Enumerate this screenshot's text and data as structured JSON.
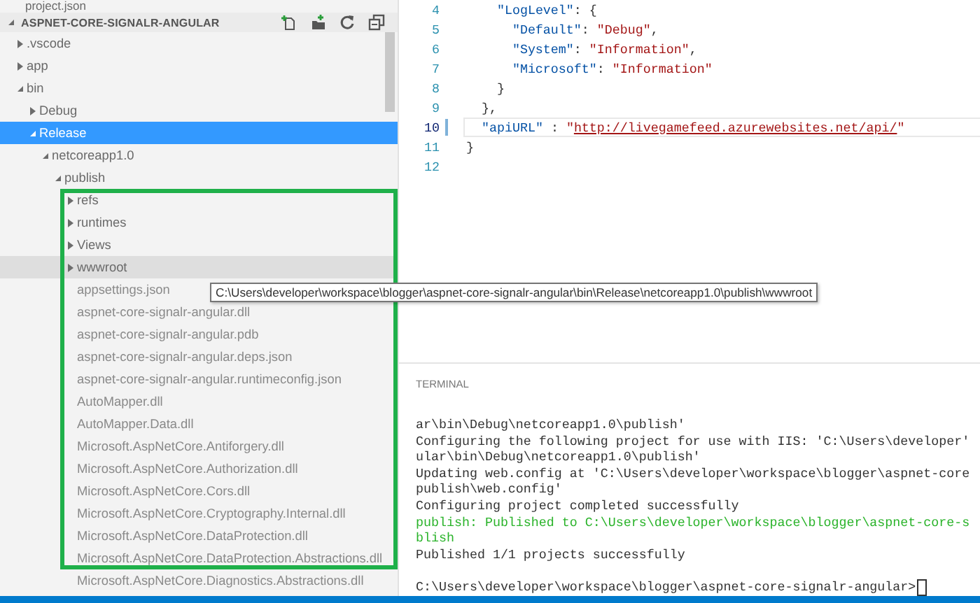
{
  "sidebar": {
    "top_item": "project.json",
    "section_title": "ASPNET-CORE-SIGNALR-ANGULAR",
    "tree": [
      {
        "label": ".vscode",
        "kind": "folder",
        "expanded": false,
        "selected": false,
        "hovered": false
      },
      {
        "label": "app",
        "kind": "folder",
        "expanded": false,
        "selected": false,
        "hovered": false
      },
      {
        "label": "bin",
        "kind": "folder",
        "expanded": true,
        "selected": false,
        "hovered": false,
        "children": [
          {
            "label": "Debug",
            "kind": "folder",
            "expanded": false,
            "selected": false,
            "hovered": false
          },
          {
            "label": "Release",
            "kind": "folder",
            "expanded": true,
            "selected": true,
            "hovered": false,
            "children": [
              {
                "label": "netcoreapp1.0",
                "kind": "folder",
                "expanded": true,
                "selected": false,
                "hovered": false,
                "children": [
                  {
                    "label": "publish",
                    "kind": "folder",
                    "expanded": true,
                    "selected": false,
                    "hovered": false,
                    "children": [
                      {
                        "label": "refs",
                        "kind": "folder",
                        "expanded": false,
                        "selected": false,
                        "hovered": false
                      },
                      {
                        "label": "runtimes",
                        "kind": "folder",
                        "expanded": false,
                        "selected": false,
                        "hovered": false
                      },
                      {
                        "label": "Views",
                        "kind": "folder",
                        "expanded": false,
                        "selected": false,
                        "hovered": false
                      },
                      {
                        "label": "wwwroot",
                        "kind": "folder",
                        "expanded": false,
                        "selected": false,
                        "hovered": true
                      },
                      {
                        "label": "appsettings.json",
                        "kind": "file",
                        "selected": false,
                        "hovered": false
                      },
                      {
                        "label": "aspnet-core-signalr-angular.dll",
                        "kind": "file",
                        "selected": false,
                        "hovered": false
                      },
                      {
                        "label": "aspnet-core-signalr-angular.pdb",
                        "kind": "file",
                        "selected": false,
                        "hovered": false
                      },
                      {
                        "label": "aspnet-core-signalr-angular.deps.json",
                        "kind": "file",
                        "selected": false,
                        "hovered": false
                      },
                      {
                        "label": "aspnet-core-signalr-angular.runtimeconfig.json",
                        "kind": "file",
                        "selected": false,
                        "hovered": false
                      },
                      {
                        "label": "AutoMapper.dll",
                        "kind": "file",
                        "selected": false,
                        "hovered": false
                      },
                      {
                        "label": "AutoMapper.Data.dll",
                        "kind": "file",
                        "selected": false,
                        "hovered": false
                      },
                      {
                        "label": "Microsoft.AspNetCore.Antiforgery.dll",
                        "kind": "file",
                        "selected": false,
                        "hovered": false
                      },
                      {
                        "label": "Microsoft.AspNetCore.Authorization.dll",
                        "kind": "file",
                        "selected": false,
                        "hovered": false
                      },
                      {
                        "label": "Microsoft.AspNetCore.Cors.dll",
                        "kind": "file",
                        "selected": false,
                        "hovered": false
                      },
                      {
                        "label": "Microsoft.AspNetCore.Cryptography.Internal.dll",
                        "kind": "file",
                        "selected": false,
                        "hovered": false
                      },
                      {
                        "label": "Microsoft.AspNetCore.DataProtection.dll",
                        "kind": "file",
                        "selected": false,
                        "hovered": false
                      },
                      {
                        "label": "Microsoft.AspNetCore.DataProtection.Abstractions.dll",
                        "kind": "file",
                        "selected": false,
                        "hovered": false
                      },
                      {
                        "label": "Microsoft.AspNetCore.Diagnostics.Abstractions.dll",
                        "kind": "file",
                        "selected": false,
                        "hovered": false
                      }
                    ]
                  }
                ]
              }
            ]
          }
        ]
      }
    ]
  },
  "tooltip": "C:\\Users\\developer\\workspace\\blogger\\aspnet-core-signalr-angular\\bin\\Release\\netcoreapp1.0\\publish\\wwwroot",
  "editor": {
    "lines": [
      {
        "number": "4",
        "current": false,
        "segments": [
          {
            "kind": "key",
            "text": "\"LogLevel\""
          },
          {
            "kind": "punct",
            "text": ": {"
          }
        ]
      },
      {
        "number": "5",
        "current": false,
        "segments": [
          {
            "kind": "key",
            "text": "\"Default\""
          },
          {
            "kind": "punct",
            "text": ": "
          },
          {
            "kind": "string",
            "text": "\"Debug\""
          },
          {
            "kind": "punct",
            "text": ","
          }
        ]
      },
      {
        "number": "6",
        "current": false,
        "segments": [
          {
            "kind": "key",
            "text": "\"System\""
          },
          {
            "kind": "punct",
            "text": ": "
          },
          {
            "kind": "string",
            "text": "\"Information\""
          },
          {
            "kind": "punct",
            "text": ","
          }
        ]
      },
      {
        "number": "7",
        "current": false,
        "segments": [
          {
            "kind": "key",
            "text": "\"Microsoft\""
          },
          {
            "kind": "punct",
            "text": ": "
          },
          {
            "kind": "string",
            "text": "\"Information\""
          }
        ]
      },
      {
        "number": "8",
        "current": false,
        "segments": [
          {
            "kind": "punct",
            "text": "}"
          }
        ]
      },
      {
        "number": "9",
        "current": false,
        "segments": [
          {
            "kind": "punct",
            "text": "},"
          }
        ]
      },
      {
        "number": "10",
        "current": true,
        "segments": [
          {
            "kind": "key",
            "text": "\"apiURL\""
          },
          {
            "kind": "punct",
            "text": " : "
          },
          {
            "kind": "string",
            "text": "\""
          },
          {
            "kind": "link",
            "text": "http://livegamefeed.azurewebsites.net/api/"
          },
          {
            "kind": "string",
            "text": "\""
          }
        ]
      },
      {
        "number": "11",
        "current": false,
        "segments": [
          {
            "kind": "punct",
            "text": "}"
          }
        ]
      },
      {
        "number": "12",
        "current": false
      }
    ]
  },
  "terminal": {
    "title": "TERMINAL",
    "lines": [
      {
        "kind": "normal",
        "text": "ar\\bin\\Debug\\netcoreapp1.0\\publish'"
      },
      {
        "kind": "normal",
        "text": "Configuring the following project for use with IIS: 'C:\\Users\\developer'"
      },
      {
        "kind": "normal",
        "text": "ular\\bin\\Debug\\netcoreapp1.0\\publish'"
      },
      {
        "kind": "normal",
        "text": "Updating web.config at 'C:\\Users\\developer\\workspace\\blogger\\aspnet-core"
      },
      {
        "kind": "normal",
        "text": "publish\\web.config'"
      },
      {
        "kind": "normal",
        "text": "Configuring project completed successfully"
      },
      {
        "kind": "success",
        "text": "publish: Published to C:\\Users\\developer\\workspace\\blogger\\aspnet-core-s"
      },
      {
        "kind": "success",
        "text": "blish"
      },
      {
        "kind": "normal",
        "text": "Published 1/1 projects successfully"
      },
      {
        "kind": "blank"
      },
      {
        "kind": "prompt",
        "text": "C:\\Users\\developer\\workspace\\blogger\\aspnet-core-signalr-angular>"
      }
    ]
  }
}
